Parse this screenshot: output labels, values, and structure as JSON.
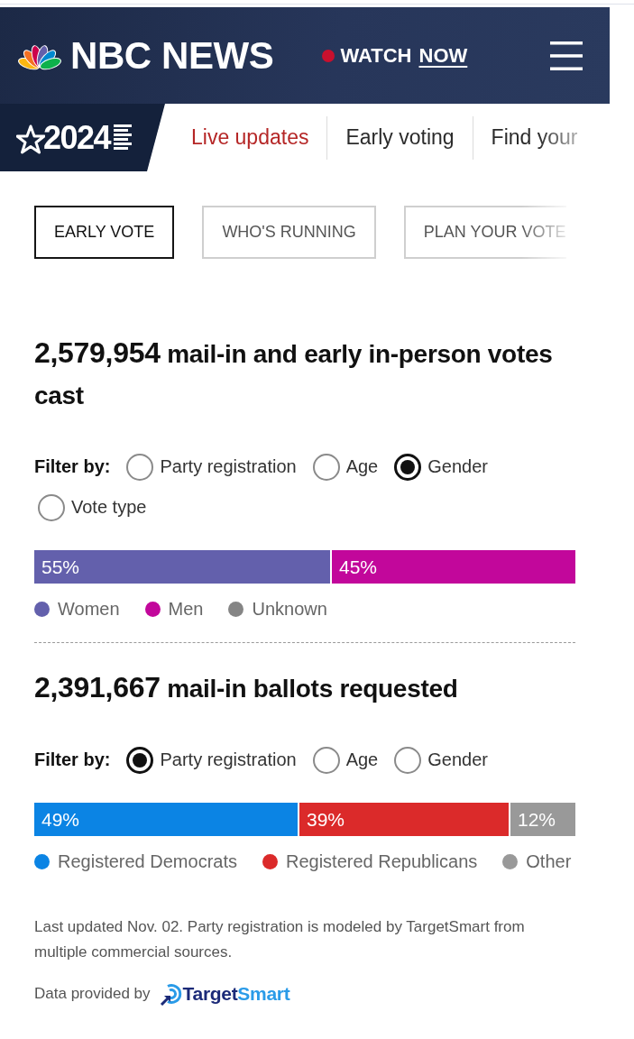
{
  "header": {
    "brand": "NBC NEWS",
    "watch": {
      "prefix": "WATCH",
      "emphasis": "NOW"
    }
  },
  "election_nav": {
    "badge": "2024",
    "links": [
      {
        "label": "Live updates",
        "selected": true
      },
      {
        "label": "Early voting",
        "selected": false
      },
      {
        "label": "Find your",
        "selected": false
      }
    ]
  },
  "tabs": [
    {
      "label": "EARLY VOTE",
      "selected": true
    },
    {
      "label": "WHO'S RUNNING",
      "selected": false
    },
    {
      "label": "PLAN YOUR VOTE",
      "selected": false
    }
  ],
  "sections": [
    {
      "count": "2,579,954",
      "title": "mail-in and early in-person votes cast",
      "filter": {
        "label": "Filter by:",
        "options": [
          {
            "label": "Party registration",
            "selected": false
          },
          {
            "label": "Age",
            "selected": false
          },
          {
            "label": "Gender",
            "selected": true
          },
          {
            "label": "Vote type",
            "selected": false
          }
        ]
      },
      "share_bar": {
        "segments": [
          {
            "label": "55%",
            "color": "#6360ac"
          },
          {
            "label": "45%",
            "color": "#c2079b"
          }
        ]
      },
      "legend": [
        {
          "label": "Women",
          "color": "#6360ac"
        },
        {
          "label": "Men",
          "color": "#c2079b"
        },
        {
          "label": "Unknown",
          "color": "#858585"
        }
      ]
    },
    {
      "count": "2,391,667",
      "title": "mail-in ballots requested",
      "filter": {
        "label": "Filter by:",
        "options": [
          {
            "label": "Party registration",
            "selected": true
          },
          {
            "label": "Age",
            "selected": false
          },
          {
            "label": "Gender",
            "selected": false
          }
        ]
      },
      "share_bar": {
        "segments": [
          {
            "label": "49%",
            "color": "#0b84e4"
          },
          {
            "label": "39%",
            "color": "#db2a2a"
          },
          {
            "label": "12%",
            "color": "#999999"
          }
        ]
      },
      "legend": [
        {
          "label": "Registered Democrats",
          "color": "#0b84e4"
        },
        {
          "label": "Registered Republicans",
          "color": "#db2a2a"
        },
        {
          "label": "Other",
          "color": "#999999"
        }
      ]
    }
  ],
  "footnote": "Last updated Nov. 02. Party registration is modeled by TargetSmart from multiple commercial sources.",
  "credit": {
    "label": "Data provided by",
    "logo": "**Target**Smart"
  }
}
